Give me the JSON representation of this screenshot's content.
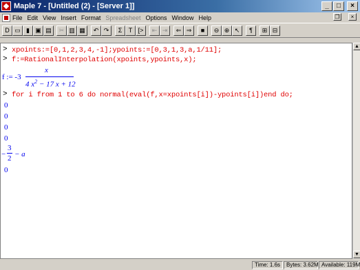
{
  "window": {
    "title": "Maple 7 - [Untitled (2) - [Server 1]]"
  },
  "menu": {
    "items": [
      "File",
      "Edit",
      "View",
      "Insert",
      "Format",
      "Spreadsheet",
      "Options",
      "Window",
      "Help"
    ]
  },
  "toolbar": {
    "buttons": [
      "D",
      "▭",
      "▮",
      "▣",
      "▤",
      "✂",
      "▥",
      "▦",
      "↶",
      "↷",
      "Σ",
      "T",
      "[>",
      "⇤",
      "⇥",
      "⇐",
      "⇒",
      "■",
      "⊖",
      "⊕",
      "↖",
      "¶",
      "⊞",
      "⊟"
    ]
  },
  "worksheet": {
    "prompt": ">",
    "cmd1": "xpoints:=[0,1,2,3,4,-1];ypoints:=[0,3,1,3,a,1/11];",
    "cmd2": "f:=RationalInterpolation(xpoints,ypoints,x);",
    "result_lhs": "f := -3",
    "result_num": "x",
    "result_den_a": "4 x",
    "result_den_exp": "2",
    "result_den_b": " − 17 x + 12",
    "cmd3": "for i from 1 to 6 do normal(eval(f,x=xpoints[i])-ypoints[i])end do;",
    "out": [
      "0",
      "0",
      "0",
      "0"
    ],
    "out5_sign": "−",
    "out5_num": "3",
    "out5_den": "2",
    "out5_tail": "− a",
    "out6": "0"
  },
  "status": {
    "time": "Time:  1.6s",
    "bytes": "Bytes:  3.62M",
    "available": "Available:  119M"
  }
}
